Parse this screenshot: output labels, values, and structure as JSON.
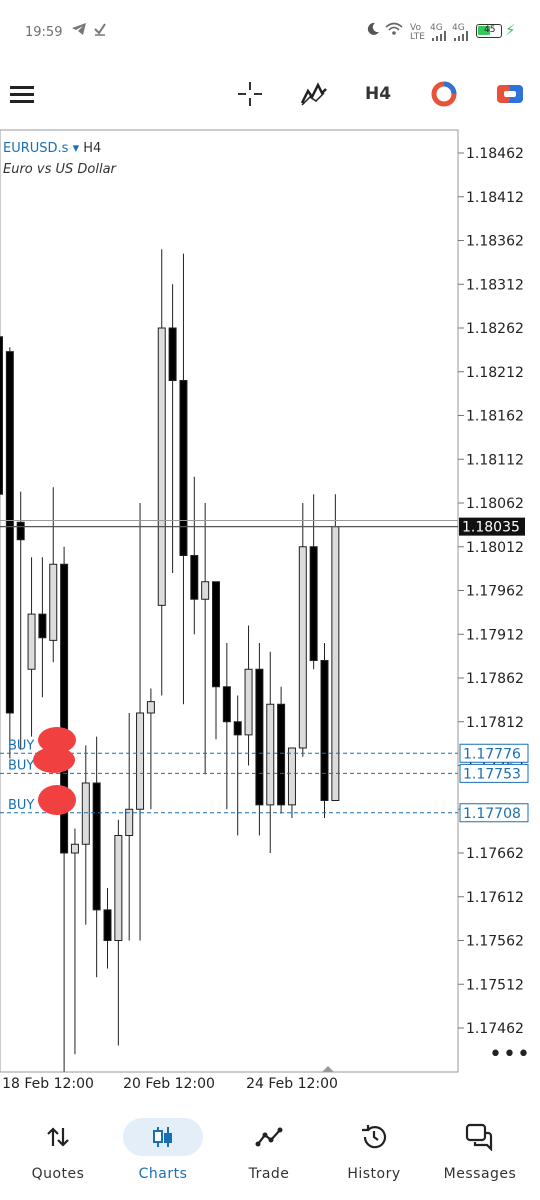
{
  "status_bar": {
    "time": "19:59",
    "volte_top": "Vo",
    "volte_bottom": "LTE",
    "net1": "4G",
    "net2": "4G",
    "battery": "45"
  },
  "toolbar": {
    "timeframe": "H4",
    "menu_icon": "hamburger-icon",
    "crosshair_icon": "crosshair-icon",
    "indicators_icon": "indicators-icon",
    "objects_icon": "objects-icon",
    "trade_icon": "one-click-trade-icon"
  },
  "chart": {
    "symbol": "EURUSD.s",
    "symbol_arrow": "▾",
    "timeframe": "H4",
    "description": "Euro vs US Dollar",
    "current_price": "1.18035",
    "more_icon": "more-dots-icon"
  },
  "chart_data": {
    "type": "candlestick",
    "y_ticks": [
      "1.18462",
      "1.18412",
      "1.18362",
      "1.18312",
      "1.18262",
      "1.18212",
      "1.18162",
      "1.18112",
      "1.18062",
      "1.18012",
      "1.17962",
      "1.17912",
      "1.17862",
      "1.17812",
      "1.17762",
      "1.17712",
      "1.17662",
      "1.17612",
      "1.17562",
      "1.17512",
      "1.17462"
    ],
    "x_ticks": [
      "18 Feb 12:00",
      "20 Feb 12:00",
      "24 Feb 12:00"
    ],
    "ylim": [
      1.17425,
      1.18475
    ],
    "bid_line": 1.18035,
    "ask_line": 1.18042,
    "orders": [
      {
        "label": "BUY",
        "price": "1.17776"
      },
      {
        "label": "BUY",
        "price": "1.17753"
      },
      {
        "label": "BUY",
        "price": "1.17708"
      }
    ],
    "candles": [
      {
        "o": 1.18252,
        "h": 1.18352,
        "l": 1.18252,
        "c": 1.18072
      },
      {
        "o": 1.18235,
        "h": 1.1824,
        "l": 1.1777,
        "c": 1.17822
      },
      {
        "o": 1.1804,
        "h": 1.18075,
        "l": 1.1778,
        "c": 1.1802
      },
      {
        "o": 1.17872,
        "h": 1.18,
        "l": 1.17795,
        "c": 1.17935
      },
      {
        "o": 1.17935,
        "h": 1.18,
        "l": 1.1784,
        "c": 1.17908
      },
      {
        "o": 1.17905,
        "h": 1.1808,
        "l": 1.1788,
        "c": 1.17992
      },
      {
        "o": 1.17992,
        "h": 1.18012,
        "l": 1.17412,
        "c": 1.17662
      },
      {
        "o": 1.17662,
        "h": 1.1769,
        "l": 1.17432,
        "c": 1.17672
      },
      {
        "o": 1.17672,
        "h": 1.17785,
        "l": 1.1758,
        "c": 1.17742
      },
      {
        "o": 1.17742,
        "h": 1.17795,
        "l": 1.1752,
        "c": 1.17597
      },
      {
        "o": 1.17597,
        "h": 1.17622,
        "l": 1.1753,
        "c": 1.17562
      },
      {
        "o": 1.17562,
        "h": 1.177,
        "l": 1.17442,
        "c": 1.17682
      },
      {
        "o": 1.17682,
        "h": 1.17822,
        "l": 1.17562,
        "c": 1.17712
      },
      {
        "o": 1.17712,
        "h": 1.18062,
        "l": 1.17562,
        "c": 1.17822
      },
      {
        "o": 1.17822,
        "h": 1.1785,
        "l": 1.17712,
        "c": 1.17835
      },
      {
        "o": 1.17945,
        "h": 1.18352,
        "l": 1.17842,
        "c": 1.18262
      },
      {
        "o": 1.18262,
        "h": 1.18312,
        "l": 1.17982,
        "c": 1.18202
      },
      {
        "o": 1.18202,
        "h": 1.18347,
        "l": 1.17832,
        "c": 1.18002
      },
      {
        "o": 1.18002,
        "h": 1.18092,
        "l": 1.17912,
        "c": 1.17952
      },
      {
        "o": 1.17952,
        "h": 1.18062,
        "l": 1.17752,
        "c": 1.17972
      },
      {
        "o": 1.17972,
        "h": 1.17972,
        "l": 1.17792,
        "c": 1.17852
      },
      {
        "o": 1.17852,
        "h": 1.17902,
        "l": 1.17712,
        "c": 1.17812
      },
      {
        "o": 1.17812,
        "h": 1.17842,
        "l": 1.17682,
        "c": 1.17797
      },
      {
        "o": 1.17797,
        "h": 1.17922,
        "l": 1.17762,
        "c": 1.17872
      },
      {
        "o": 1.17872,
        "h": 1.17902,
        "l": 1.17682,
        "c": 1.17717
      },
      {
        "o": 1.17717,
        "h": 1.17892,
        "l": 1.17662,
        "c": 1.17832
      },
      {
        "o": 1.17832,
        "h": 1.17852,
        "l": 1.17707,
        "c": 1.17717
      },
      {
        "o": 1.17717,
        "h": 1.17772,
        "l": 1.17702,
        "c": 1.17782
      },
      {
        "o": 1.17782,
        "h": 1.18062,
        "l": 1.17772,
        "c": 1.18012
      },
      {
        "o": 1.18012,
        "h": 1.18072,
        "l": 1.17872,
        "c": 1.17882
      },
      {
        "o": 1.17882,
        "h": 1.17902,
        "l": 1.17702,
        "c": 1.17722
      },
      {
        "o": 1.17722,
        "h": 1.18072,
        "l": 1.17722,
        "c": 1.18035
      }
    ],
    "colors": {
      "bull_body": "#dcdcdc",
      "bear_body": "#000000",
      "order_line": "#1a6fb3",
      "bid_line": "#555555"
    }
  },
  "bottom_nav": {
    "items": [
      {
        "label": "Quotes",
        "icon": "quotes-icon"
      },
      {
        "label": "Charts",
        "icon": "charts-icon"
      },
      {
        "label": "Trade",
        "icon": "trade-icon"
      },
      {
        "label": "History",
        "icon": "history-icon"
      },
      {
        "label": "Messages",
        "icon": "messages-icon"
      }
    ],
    "active": "Charts"
  }
}
